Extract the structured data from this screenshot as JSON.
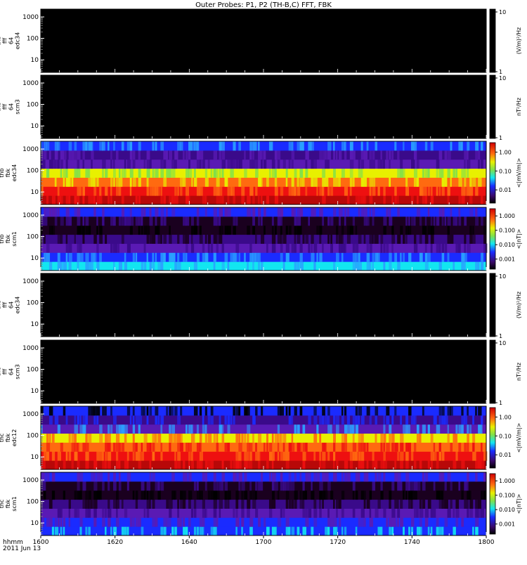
{
  "title": "Outer Probes: P1, P2 (TH-B,C) FFT, FBK",
  "x_axis": {
    "row_label_1": "hhmm",
    "row_label_2": "2011 Jun 13",
    "ticks": [
      "1600",
      "1620",
      "1640",
      "1700",
      "1720",
      "1740",
      "1800"
    ]
  },
  "palette": {
    "black": "#000000",
    "dark_purple": "#1a001f",
    "purple": "#3a0a8a",
    "violet": "#5a1ab4",
    "blue": "#1a2bff",
    "light_blue": "#2aa0ff",
    "cyan": "#12e6f0",
    "green": "#7fe04a",
    "yellow": "#e8f000",
    "orange": "#ff6a10",
    "red": "#ee1010",
    "dark_red": "#b80808"
  },
  "chart_data": [
    {
      "type": "heatmap",
      "ylabel": "thb\nfff\n64\nedc34",
      "y_ticks": [
        "10",
        "100",
        "1000"
      ],
      "colorbar_ticks": [
        "1",
        "10"
      ],
      "colorbar_label": "(V/m)²/Hz",
      "colorbar_type": "short",
      "fill": "empty",
      "bands": []
    },
    {
      "type": "heatmap",
      "ylabel": "thb\nfff\n64\nscm3",
      "y_ticks": [
        "10",
        "100",
        "1000"
      ],
      "colorbar_ticks": [
        "1",
        "10"
      ],
      "colorbar_label": "nT²/Hz",
      "colorbar_type": "short",
      "fill": "empty",
      "bands": []
    },
    {
      "type": "heatmap",
      "ylabel": "thb\nfbk\nedc34",
      "y_ticks": [
        "10",
        "100",
        "1000"
      ],
      "colorbar_ticks": [
        "0.01",
        "0.10",
        "1.00"
      ],
      "colorbar_label": "<|mV/m|>",
      "colorbar_type": "full",
      "fill": "bands",
      "bands": [
        {
          "color": "dark_red",
          "alt": "red"
        },
        {
          "color": "red",
          "alt": "orange"
        },
        {
          "color": "orange",
          "alt": "yellow"
        },
        {
          "color": "yellow",
          "alt": "green"
        },
        {
          "color": "violet",
          "alt": "purple"
        },
        {
          "color": "purple",
          "alt": "violet"
        },
        {
          "color": "blue",
          "alt": "light_blue"
        }
      ]
    },
    {
      "type": "heatmap",
      "ylabel": "thb\nfbk\nscm1",
      "y_ticks": [
        "10",
        "100",
        "1000"
      ],
      "colorbar_ticks": [
        "0.001",
        "0.010",
        "0.100",
        "1.000"
      ],
      "colorbar_label": "<|nT|>",
      "colorbar_type": "full",
      "fill": "bands",
      "bands": [
        {
          "color": "cyan",
          "alt": "light_blue"
        },
        {
          "color": "blue",
          "alt": "light_blue"
        },
        {
          "color": "violet",
          "alt": "purple"
        },
        {
          "color": "purple",
          "alt": "dark_purple"
        },
        {
          "color": "dark_purple",
          "alt": "black"
        },
        {
          "color": "dark_purple",
          "alt": "purple"
        },
        {
          "color": "blue",
          "alt": "violet"
        }
      ]
    },
    {
      "type": "heatmap",
      "ylabel": "thc\nfff\n64\nedc34",
      "y_ticks": [
        "10",
        "100",
        "1000"
      ],
      "colorbar_ticks": [
        "1",
        "10"
      ],
      "colorbar_label": "(V/m)²/Hz",
      "colorbar_type": "short",
      "fill": "empty",
      "bands": []
    },
    {
      "type": "heatmap",
      "ylabel": "thc\nfff\n64\nscm3",
      "y_ticks": [
        "10",
        "100",
        "1000"
      ],
      "colorbar_ticks": [
        "1",
        "10"
      ],
      "colorbar_label": "nT²/Hz",
      "colorbar_type": "short",
      "fill": "empty",
      "bands": []
    },
    {
      "type": "heatmap",
      "ylabel": "thc\nfbk\nedc12",
      "y_ticks": [
        "10",
        "100",
        "1000"
      ],
      "colorbar_ticks": [
        "0.01",
        "0.10",
        "1.00"
      ],
      "colorbar_label": "<|mV/m|>",
      "colorbar_type": "full",
      "fill": "bands",
      "bands": [
        {
          "color": "dark_red",
          "alt": "red"
        },
        {
          "color": "red",
          "alt": "orange"
        },
        {
          "color": "orange",
          "alt": "red"
        },
        {
          "color": "yellow",
          "alt": "orange"
        },
        {
          "color": "violet",
          "alt": "light_blue"
        },
        {
          "color": "purple",
          "alt": "blue"
        },
        {
          "color": "blue",
          "alt": "black"
        }
      ]
    },
    {
      "type": "heatmap",
      "ylabel": "thc\nfbk\nscm1",
      "y_ticks": [
        "10",
        "100",
        "1000"
      ],
      "colorbar_ticks": [
        "0.001",
        "0.010",
        "0.100",
        "1.000"
      ],
      "colorbar_label": "<|nT|>",
      "colorbar_type": "full",
      "fill": "bands",
      "bands": [
        {
          "color": "blue",
          "alt": "cyan"
        },
        {
          "color": "blue",
          "alt": "violet"
        },
        {
          "color": "violet",
          "alt": "purple"
        },
        {
          "color": "purple",
          "alt": "dark_purple"
        },
        {
          "color": "dark_purple",
          "alt": "black"
        },
        {
          "color": "dark_purple",
          "alt": "purple"
        },
        {
          "color": "blue",
          "alt": "violet"
        }
      ]
    }
  ]
}
